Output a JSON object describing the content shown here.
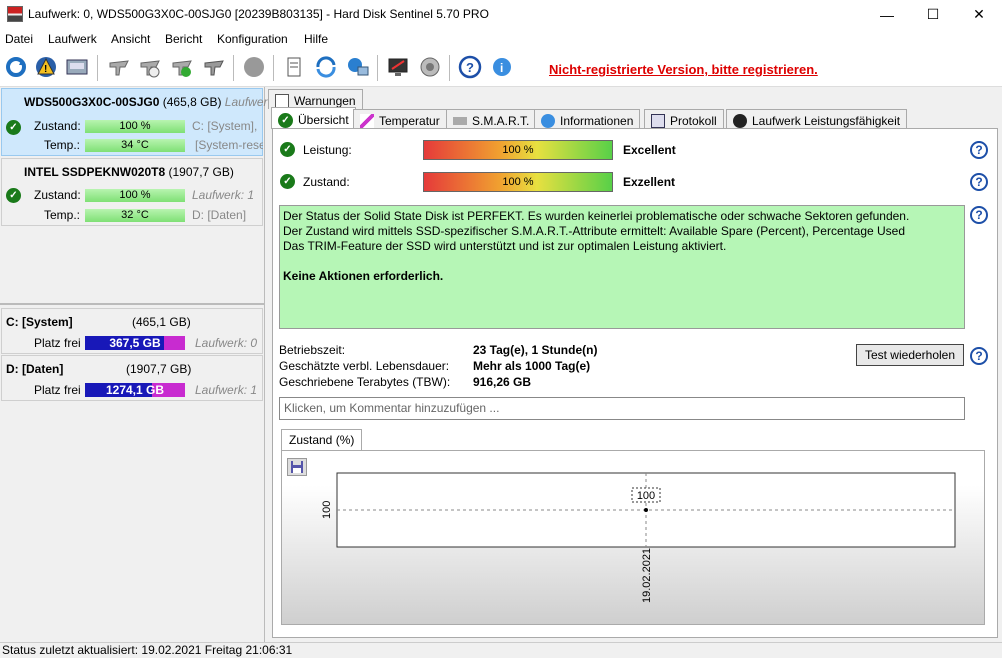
{
  "window": {
    "title": "Laufwerk: 0, WDS500G3X0C-00SJG0 [20239B803135]  -  Hard Disk Sentinel 5.70 PRO",
    "min": "—",
    "max": "☐",
    "close": "✕"
  },
  "menu": [
    "Datei",
    "Laufwerk",
    "Ansicht",
    "Bericht",
    "Konfiguration",
    "Hilfe"
  ],
  "toolbar": {
    "register_link": "Nicht-registrierte Version, bitte registrieren."
  },
  "drives": [
    {
      "name": "WDS500G3X0C-00SJG0",
      "size": "(465,8 GB)",
      "extra": "Laufwer",
      "zustand_label": "Zustand:",
      "zustand": "100 %",
      "zustand_right": "C: [System],",
      "temp_label": "Temp.:",
      "temp": "34 °C",
      "temp_right": "[System-rese"
    },
    {
      "name": "INTEL SSDPEKNW020T8",
      "size": "(1907,7 GB)",
      "zustand_label": "Zustand:",
      "zustand": "100 %",
      "zustand_right": "Laufwerk: 1",
      "temp_label": "Temp.:",
      "temp": "32 °C",
      "temp_right": "D: [Daten]"
    }
  ],
  "volumes": [
    {
      "name": "C: [System]",
      "size": "(465,1 GB)",
      "free_label": "Platz frei",
      "free": "367,5 GB",
      "free_fraction": 0.79,
      "disk": "Laufwerk: 0"
    },
    {
      "name": "D: [Daten]",
      "size": "(1907,7 GB)",
      "free_label": "Platz frei",
      "free": "1274,1 GB",
      "free_fraction": 0.67,
      "disk": "Laufwerk: 1"
    }
  ],
  "tabs": {
    "row1": [
      "Warnungen"
    ],
    "row2": [
      "Übersicht",
      "Temperatur",
      "S.M.A.R.T.",
      "Informationen",
      "Protokoll",
      "Laufwerk Leistungsfähigkeit"
    ]
  },
  "overview": {
    "leistung_label": "Leistung:",
    "leistung_value": "100 %",
    "leistung_rating": "Excellent",
    "zustand_label": "Zustand:",
    "zustand_value": "100 %",
    "zustand_rating": "Exzellent",
    "status_lines": [
      "Der Status der Solid State Disk ist PERFEKT. Es wurden keinerlei problematische oder schwache Sektoren gefunden.",
      "Der Zustand wird mittels SSD-spezifischer S.M.A.R.T.-Attribute ermittelt:  Available Spare (Percent), Percentage Used",
      "Das TRIM-Feature der SSD wird unterstützt und ist zur optimalen Leistung aktiviert."
    ],
    "status_action": "Keine Aktionen erforderlich.",
    "betriebszeit_label": "Betriebszeit:",
    "betriebszeit": "23 Tag(e), 1 Stunde(n)",
    "lebensdauer_label": "Geschätzte verbl. Lebensdauer:",
    "lebensdauer": "Mehr als 1000 Tag(e)",
    "tbw_label": "Geschriebene Terabytes (TBW):",
    "tbw": "916,26 GB",
    "test_button": "Test wiederholen",
    "comment_placeholder": "Klicken, um Kommentar hinzuzufügen ...",
    "chart_tab": "Zustand (%)"
  },
  "chart_data": {
    "type": "line",
    "x": [
      "19.02.2021"
    ],
    "series": [
      {
        "values": [
          100
        ]
      }
    ],
    "ylabel": "100",
    "point_label": "100"
  },
  "statusbar": "Status zuletzt aktualisiert: 19.02.2021 Freitag 21:06:31"
}
